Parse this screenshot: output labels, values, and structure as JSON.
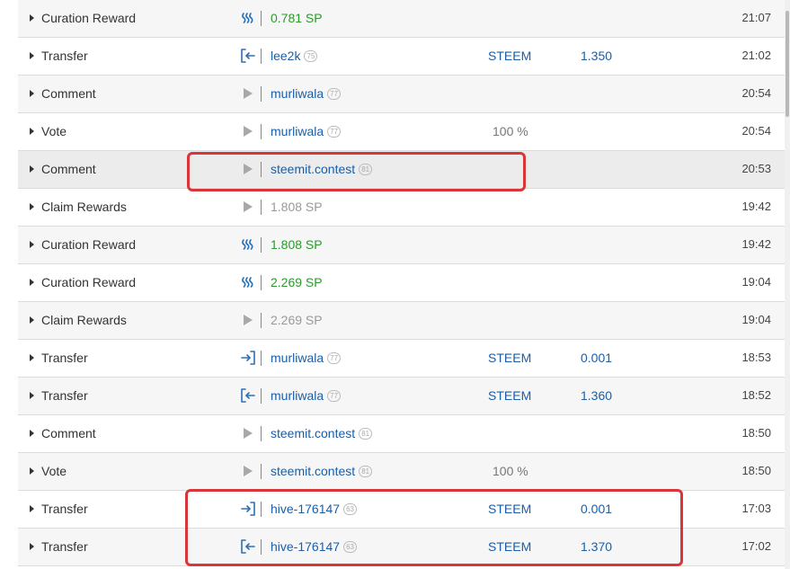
{
  "colors": {
    "link": "#1a5ea8",
    "sp_green": "#2a9a2a",
    "muted": "#999999",
    "highlight_box": "#d9363a"
  },
  "transactions": [
    {
      "type": "Curation Reward",
      "icon": "steem-icon",
      "value": "0.781 SP",
      "style": "sp",
      "time": "21:07"
    },
    {
      "type": "Transfer",
      "icon": "transfer-in-icon",
      "value": "lee2k",
      "rep": "75",
      "style": "user",
      "asset": "STEEM",
      "amount": "1.350",
      "time": "21:02"
    },
    {
      "type": "Comment",
      "icon": "play-icon",
      "value": "murliwala",
      "rep": "77",
      "style": "user",
      "time": "20:54"
    },
    {
      "type": "Vote",
      "icon": "play-icon",
      "value": "murliwala",
      "rep": "77",
      "style": "user",
      "percent": "100 %",
      "time": "20:54"
    },
    {
      "type": "Comment",
      "icon": "play-icon",
      "value": "steemit.contest",
      "rep": "81",
      "style": "user",
      "time": "20:53",
      "hover": true
    },
    {
      "type": "Claim Rewards",
      "icon": "play-icon",
      "value": "1.808 SP",
      "style": "grey",
      "time": "19:42"
    },
    {
      "type": "Curation Reward",
      "icon": "steem-icon",
      "value": "1.808 SP",
      "style": "sp",
      "time": "19:42"
    },
    {
      "type": "Curation Reward",
      "icon": "steem-icon",
      "value": "2.269 SP",
      "style": "sp",
      "time": "19:04"
    },
    {
      "type": "Claim Rewards",
      "icon": "play-icon",
      "value": "2.269 SP",
      "style": "grey",
      "time": "19:04"
    },
    {
      "type": "Transfer",
      "icon": "transfer-out-icon",
      "value": "murliwala",
      "rep": "77",
      "style": "user",
      "asset": "STEEM",
      "amount": "0.001",
      "time": "18:53"
    },
    {
      "type": "Transfer",
      "icon": "transfer-in-icon",
      "value": "murliwala",
      "rep": "77",
      "style": "user",
      "asset": "STEEM",
      "amount": "1.360",
      "time": "18:52"
    },
    {
      "type": "Comment",
      "icon": "play-icon",
      "value": "steemit.contest",
      "rep": "81",
      "style": "user",
      "time": "18:50"
    },
    {
      "type": "Vote",
      "icon": "play-icon",
      "value": "steemit.contest",
      "rep": "81",
      "style": "user",
      "percent": "100 %",
      "time": "18:50"
    },
    {
      "type": "Transfer",
      "icon": "transfer-out-icon",
      "value": "hive-176147",
      "rep": "63",
      "style": "user",
      "asset": "STEEM",
      "amount": "0.001",
      "time": "17:03"
    },
    {
      "type": "Transfer",
      "icon": "transfer-in-icon",
      "value": "hive-176147",
      "rep": "63",
      "style": "user",
      "asset": "STEEM",
      "amount": "1.370",
      "time": "17:02"
    }
  ]
}
